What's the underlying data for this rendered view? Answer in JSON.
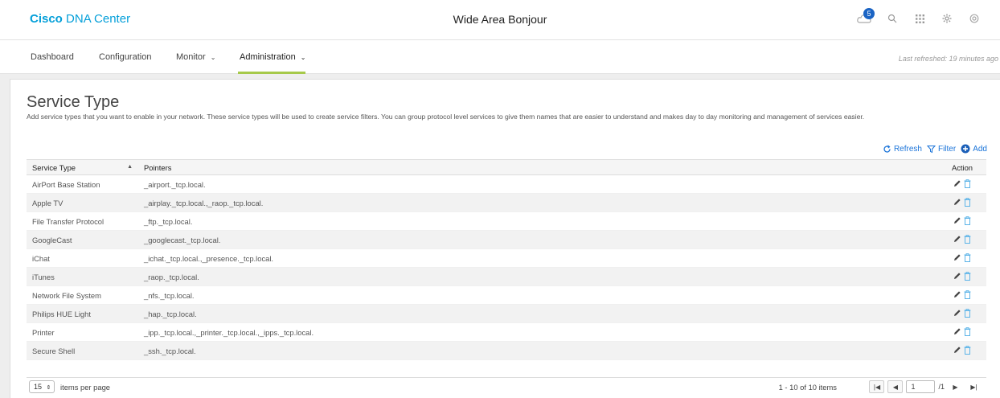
{
  "header": {
    "brand_bold": "Cisco",
    "brand_rest": "DNA Center",
    "title": "Wide Area Bonjour",
    "notification_count": "5",
    "icons": [
      "cloud-notification-icon",
      "search-icon",
      "apps-grid-icon",
      "gear-icon",
      "help-icon"
    ]
  },
  "nav": {
    "items": [
      {
        "label": "Dashboard"
      },
      {
        "label": "Configuration"
      },
      {
        "label": "Monitor"
      },
      {
        "label": "Administration"
      }
    ],
    "active": "Administration",
    "last_refreshed": "Last refreshed: 19 minutes ago"
  },
  "page": {
    "title": "Service Type",
    "description": "Add service types that you want to enable in your network. These service types will be used to create service filters. You can group protocol level services to give them names that are easier to understand and makes day to day monitoring and management of services easier."
  },
  "actions": {
    "refresh": "Refresh",
    "filter": "Filter",
    "add": "Add"
  },
  "table": {
    "columns": [
      "Service Type",
      "Pointers",
      "Action"
    ],
    "rows": [
      {
        "service": "AirPort Base Station",
        "pointers": "_airport._tcp.local."
      },
      {
        "service": "Apple TV",
        "pointers": "_airplay._tcp.local.,_raop._tcp.local."
      },
      {
        "service": "File Transfer Protocol",
        "pointers": "_ftp._tcp.local."
      },
      {
        "service": "GoogleCast",
        "pointers": "_googlecast._tcp.local."
      },
      {
        "service": "iChat",
        "pointers": "_ichat._tcp.local.,_presence._tcp.local."
      },
      {
        "service": "iTunes",
        "pointers": "_raop._tcp.local."
      },
      {
        "service": "Network File System",
        "pointers": "_nfs._tcp.local."
      },
      {
        "service": "Philips HUE Light",
        "pointers": "_hap._tcp.local."
      },
      {
        "service": "Printer",
        "pointers": "_ipp._tcp.local.,_printer._tcp.local.,_ipps._tcp.local."
      },
      {
        "service": "Secure Shell",
        "pointers": "_ssh._tcp.local."
      }
    ]
  },
  "footer": {
    "items_per_page": "15",
    "items_per_page_label": "items per page",
    "range": "1 - 10 of 10 items",
    "page": "1",
    "total_pages": "/1"
  },
  "colors": {
    "brand": "#049fd9",
    "accent_link": "#1b74d9",
    "nav_underline": "#a6c94a",
    "badge": "#1b64c4"
  }
}
